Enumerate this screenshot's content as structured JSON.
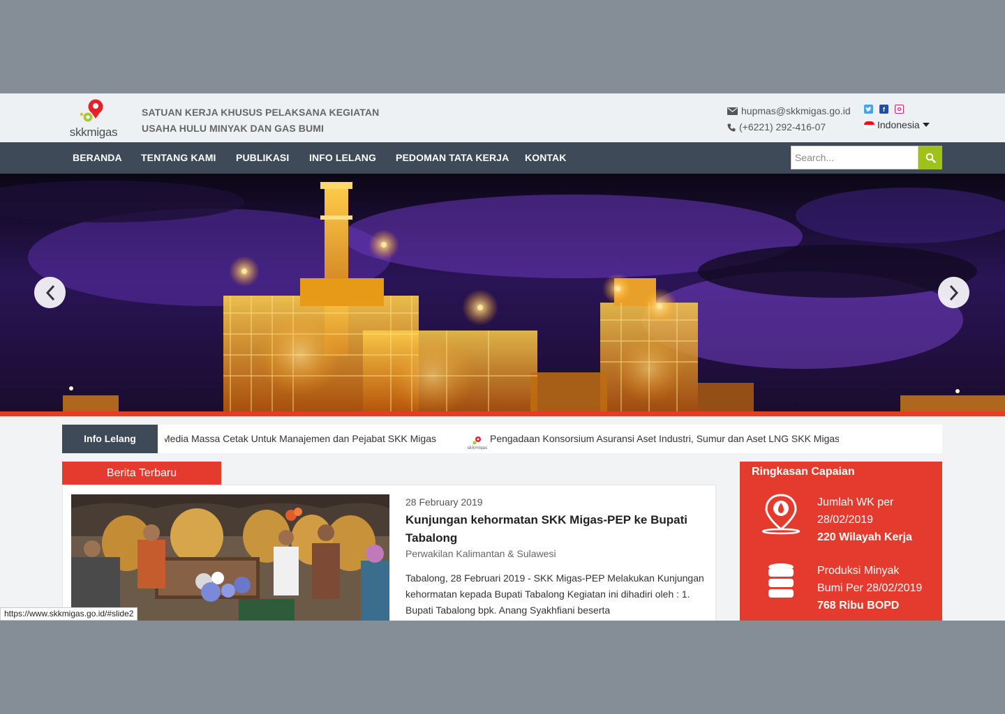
{
  "header": {
    "logo_text": "skkmigas",
    "agency_line1": "SATUAN KERJA KHUSUS PELAKSANA KEGIATAN",
    "agency_line2": "USAHA HULU MINYAK DAN GAS BUMI",
    "email": "hupmas@skkmigas.go.id",
    "phone": "(+6221) 292-416-07",
    "language": "Indonesia",
    "social_icons": [
      "twitter-icon",
      "facebook-icon",
      "instagram-icon"
    ]
  },
  "nav": {
    "items": [
      "BERANDA",
      "TENTANG KAMI",
      "PUBLIKASI",
      "INFO LELANG",
      "PEDOMAN TATA KERJA",
      "KONTAK"
    ],
    "search_placeholder": "Search..."
  },
  "ticker": {
    "label": "Info Lelang",
    "item1": "Media Massa Cetak Untuk Manajemen dan Pejabat SKK Migas",
    "item2": "Pengadaan Konsorsium Asuransi Aset Industri, Sumur dan Aset LNG SKK Migas"
  },
  "berita": {
    "tab_label": "Berita Terbaru",
    "date": "28 February 2019",
    "title": "Kunjungan kehormatan SKK Migas-PEP ke Bupati Tabalong",
    "region": "Perwakilan Kalimantan & Sulawesi",
    "body": "Tabalong, 28 Februari 2019 - SKK Migas-PEP Melakukan Kunjungan kehormatan kepada Bupati Tabalong Kegiatan ini dihadiri oleh : 1. Bupati Tabalong bpk. Anang Syakhfiani beserta"
  },
  "summary": {
    "title": "Ringkasan Capaian",
    "item1_line1": "Jumlah WK per",
    "item1_line2": "28/02/2019",
    "item1_value": "220 Wilayah Kerja",
    "item2_line1": "Produksi Minyak",
    "item2_line2": "Bumi Per 28/02/2019",
    "item2_value": "768 Ribu BOPD"
  },
  "status_bar": "https://www.skkmigas.go.id/#slide2",
  "colors": {
    "accent_red": "#e53b2e",
    "nav_bg": "#3e4a57",
    "search_green": "#9fc21b"
  }
}
